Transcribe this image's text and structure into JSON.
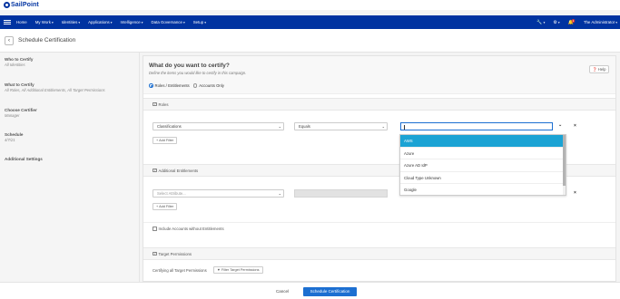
{
  "brand": {
    "name": "SailPoint",
    "color": "#0033a1"
  },
  "nav": {
    "items": [
      "Home",
      "My Work",
      "Identities",
      "Applications",
      "Intelligence",
      "Data Governance",
      "Setup"
    ],
    "user": "The Administrator",
    "notifications": "1",
    "icons": [
      "wrench-icon",
      "gear-icon",
      "bell-icon"
    ]
  },
  "page": {
    "title": "Schedule Certification",
    "back_icon": "chevron-left-icon"
  },
  "sidebar": {
    "steps": [
      {
        "title": "Who to Certify",
        "subtitle": "All Identities"
      },
      {
        "title": "What to Certify",
        "subtitle": "All Roles, All Additional Entitlements, All Target Permissions"
      },
      {
        "title": "Choose Certifier",
        "subtitle": "Manager"
      },
      {
        "title": "Schedule",
        "subtitle": "4/7/21"
      },
      {
        "title": "Additional Settings",
        "subtitle": ""
      }
    ]
  },
  "main": {
    "title": "What do you want to certify?",
    "subtitle": "Define the items you would like to certify in this campaign.",
    "radio_roles": "Roles / Entitlements",
    "radio_accounts": "Accounts Only",
    "help": "Help",
    "roles": {
      "label": "Roles",
      "attribute": "Classifications",
      "operator": "Equals",
      "value": "",
      "add_filter": "+ Add Filter"
    },
    "additional": {
      "label": "Additional Entitlements",
      "attribute_placeholder": "Select Attribute...",
      "add_filter": "+ Add Filter",
      "include_accounts": "Include Accounts without Entitlements"
    },
    "target": {
      "label": "Target Permissions",
      "text": "Certifying all Target Permissions",
      "filter_button": "Filter Target Permissions"
    },
    "dropdown_options": [
      "AWS",
      "Azure",
      "Azure AD IdP",
      "Cloud Type Unknown",
      "Google"
    ],
    "dropdown_selected": "AWS"
  },
  "footer": {
    "cancel": "Cancel",
    "submit": "Schedule Certification"
  },
  "colors": {
    "primary": "#1c6fd1",
    "dropdown_highlight": "#1ba3d4",
    "nav_bg": "#0033a1"
  }
}
